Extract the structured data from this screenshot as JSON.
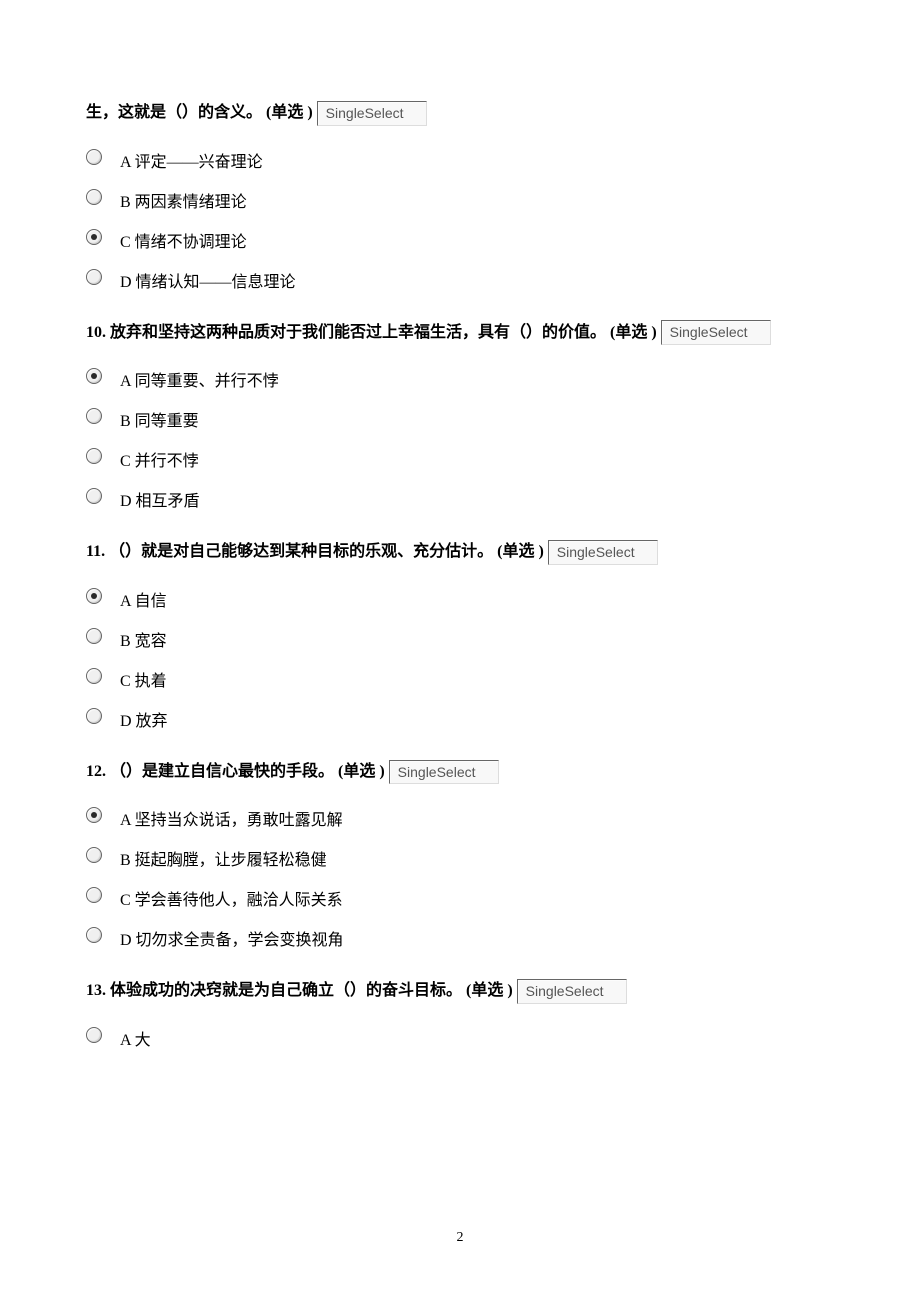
{
  "tag": "SingleSelect",
  "page_number": "2",
  "questions": [
    {
      "id": "q9",
      "text": "生，这就是（）的含义。 (单选 )",
      "options": [
        {
          "label": "A 评定——兴奋理论",
          "checked": false
        },
        {
          "label": "B 两因素情绪理论",
          "checked": false
        },
        {
          "label": "C 情绪不协调理论",
          "checked": true
        },
        {
          "label": "D 情绪认知——信息理论",
          "checked": false
        }
      ]
    },
    {
      "id": "q10",
      "text": "10. 放弃和坚持这两种品质对于我们能否过上幸福生活，具有（）的价值。 (单选 )",
      "options": [
        {
          "label": "A 同等重要、并行不悖",
          "checked": true
        },
        {
          "label": "B 同等重要",
          "checked": false
        },
        {
          "label": "C 并行不悖",
          "checked": false
        },
        {
          "label": "D 相互矛盾",
          "checked": false
        }
      ]
    },
    {
      "id": "q11",
      "text": "11. （）就是对自己能够达到某种目标的乐观、充分估计。 (单选 )",
      "options": [
        {
          "label": "A 自信",
          "checked": true
        },
        {
          "label": "B 宽容",
          "checked": false
        },
        {
          "label": "C 执着",
          "checked": false
        },
        {
          "label": "D 放弃",
          "checked": false
        }
      ]
    },
    {
      "id": "q12",
      "text": "12. （）是建立自信心最快的手段。 (单选 )",
      "options": [
        {
          "label": "A 坚持当众说话，勇敢吐露见解",
          "checked": true
        },
        {
          "label": "B 挺起胸膛，让步履轻松稳健",
          "checked": false
        },
        {
          "label": "C 学会善待他人，融洽人际关系",
          "checked": false
        },
        {
          "label": "D 切勿求全责备，学会变换视角",
          "checked": false
        }
      ]
    },
    {
      "id": "q13",
      "text": "13. 体验成功的决窍就是为自己确立（）的奋斗目标。 (单选 )",
      "options": [
        {
          "label": "A 大",
          "checked": false
        }
      ]
    }
  ]
}
